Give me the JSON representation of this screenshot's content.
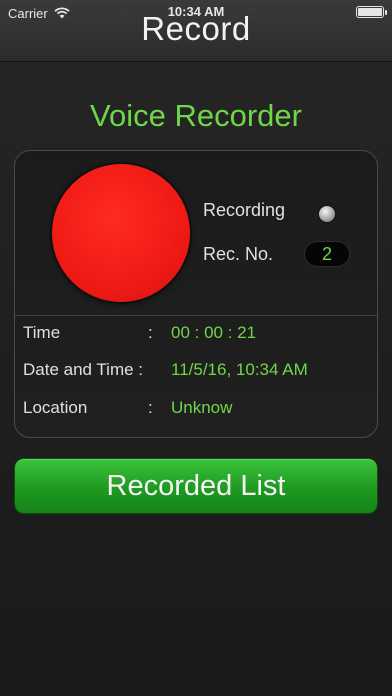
{
  "status_bar": {
    "carrier": "Carrier",
    "time": "10:34 AM"
  },
  "navbar": {
    "title": "Record"
  },
  "app": {
    "title": "Voice Recorder"
  },
  "recorder": {
    "recording_label": "Recording",
    "rec_no_label": "Rec. No.",
    "rec_no_value": "2"
  },
  "info": {
    "time_label": "Time",
    "time_colon": ":",
    "time_value": "00 : 00 : 21",
    "datetime_label": "Date and Time :",
    "datetime_value": "11/5/16, 10:34 AM",
    "location_label": "Location",
    "location_colon": ":",
    "location_value": "Unknow"
  },
  "actions": {
    "recorded_list_label": "Recorded List"
  },
  "colors": {
    "accent_green": "#6fd64a",
    "record_red": "#f01a14",
    "button_green": "#1f9a21"
  }
}
